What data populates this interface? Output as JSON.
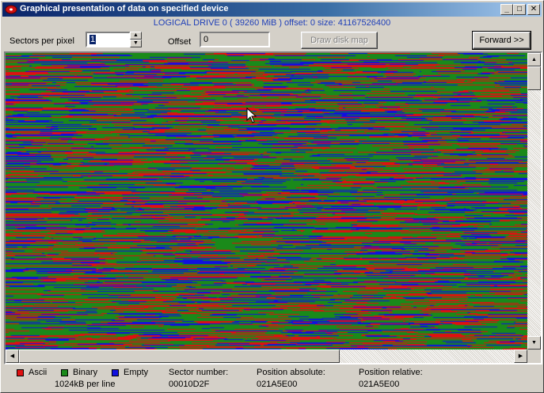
{
  "window": {
    "title": "Graphical presentation of data on specified device",
    "minimize_glyph": "_",
    "maximize_glyph": "□",
    "close_glyph": "✕"
  },
  "info_line": "LOGICAL DRIVE 0   ( 39260 MiB ) offset: 0 size: 41167526400",
  "controls": {
    "sectors_per_pixel_label": "Sectors per pixel",
    "sectors_per_pixel_value": "1",
    "offset_label": "Offset",
    "offset_value": "0",
    "draw_disk_map_label": "Draw disk map",
    "forward_label": "Forward >>"
  },
  "legend": {
    "ascii": {
      "label": "Ascii",
      "color": "#e01010"
    },
    "binary": {
      "label": "Binary",
      "color": "#1a8a1a"
    },
    "empty": {
      "label": "Empty",
      "color": "#1010e0"
    },
    "per_line": "1024kB per line"
  },
  "status": {
    "sector_number_label": "Sector number:",
    "sector_number_value": "00010D2F",
    "position_absolute_label": "Position absolute:",
    "position_absolute_value": "021A5E00",
    "position_relative_label": "Position relative:",
    "position_relative_value": "021A5E00"
  },
  "icons": {
    "app": "red-disk-icon",
    "cursor": "mouse-pointer-icon"
  }
}
